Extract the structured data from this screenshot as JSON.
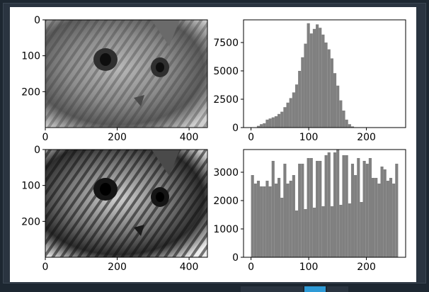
{
  "colors": {
    "page_bg": "#1d2731",
    "figure_bg": "#ffffff",
    "hist_fill": "#808080",
    "accent": "#2e9ad6"
  },
  "chart_data": [
    {
      "type": "image",
      "title": "",
      "description_ticks_x": [
        "0",
        "200",
        "400"
      ],
      "description_ticks_y": [
        "0",
        "100",
        "200"
      ],
      "xlim": [
        0,
        451
      ],
      "ylim": [
        0,
        300
      ],
      "xticks": [
        0,
        200,
        400
      ],
      "yticks": [
        0,
        100,
        200
      ]
    },
    {
      "type": "bar",
      "title": "",
      "xlabel": "",
      "ylabel": "",
      "xlim": [
        -13,
        268
      ],
      "ylim": [
        0,
        9500
      ],
      "xticks": [
        0,
        100,
        200
      ],
      "yticks": [
        0,
        2500,
        5000,
        7500
      ],
      "x_start": 0,
      "bin_width": 5.1,
      "values": [
        0,
        0,
        150,
        300,
        380,
        700,
        800,
        900,
        1000,
        1200,
        1400,
        1800,
        2200,
        2600,
        3100,
        3800,
        5000,
        6200,
        7400,
        9200,
        8300,
        8700,
        9100,
        8800,
        8200,
        7500,
        6900,
        6100,
        4800,
        3700,
        2400,
        1500,
        700,
        300,
        100,
        0,
        0,
        0,
        0,
        0,
        0,
        0,
        0,
        0,
        0,
        0,
        0,
        0,
        0,
        0
      ]
    },
    {
      "type": "image",
      "title": "",
      "xlim": [
        0,
        451
      ],
      "ylim": [
        0,
        300
      ],
      "xticks": [
        0,
        200,
        400
      ],
      "yticks": [
        0,
        100,
        200
      ]
    },
    {
      "type": "bar",
      "title": "",
      "xlabel": "",
      "ylabel": "",
      "xlim": [
        -13,
        268
      ],
      "ylim": [
        0,
        3800
      ],
      "xticks": [
        0,
        100,
        200
      ],
      "yticks": [
        0,
        1000,
        2000,
        3000
      ],
      "x_start": 0,
      "bin_width": 5.1,
      "values": [
        2900,
        2600,
        2700,
        2500,
        2500,
        2700,
        2500,
        3400,
        2600,
        2800,
        2100,
        3300,
        2600,
        2700,
        2900,
        1650,
        3300,
        3300,
        1700,
        3500,
        3500,
        1750,
        3400,
        3400,
        1800,
        3600,
        3700,
        1800,
        3700,
        3800,
        1850,
        3600,
        3600,
        1900,
        3300,
        2900,
        3500,
        1950,
        3400,
        3300,
        3500,
        2800,
        2800,
        2600,
        3200,
        3100,
        2700,
        2800,
        2600,
        3300
      ]
    }
  ],
  "axes_labels": {
    "ax1_y": [
      "0",
      "100",
      "200"
    ],
    "ax1_x": [
      "0",
      "200",
      "400"
    ],
    "ax2_y": [
      "0",
      "2500",
      "5000",
      "7500"
    ],
    "ax2_x": [
      "0",
      "100",
      "200"
    ],
    "ax3_y": [
      "0",
      "100",
      "200"
    ],
    "ax3_x": [
      "0",
      "200",
      "400"
    ],
    "ax4_y": [
      "0",
      "1000",
      "2000",
      "3000"
    ],
    "ax4_x": [
      "0",
      "100",
      "200"
    ]
  }
}
